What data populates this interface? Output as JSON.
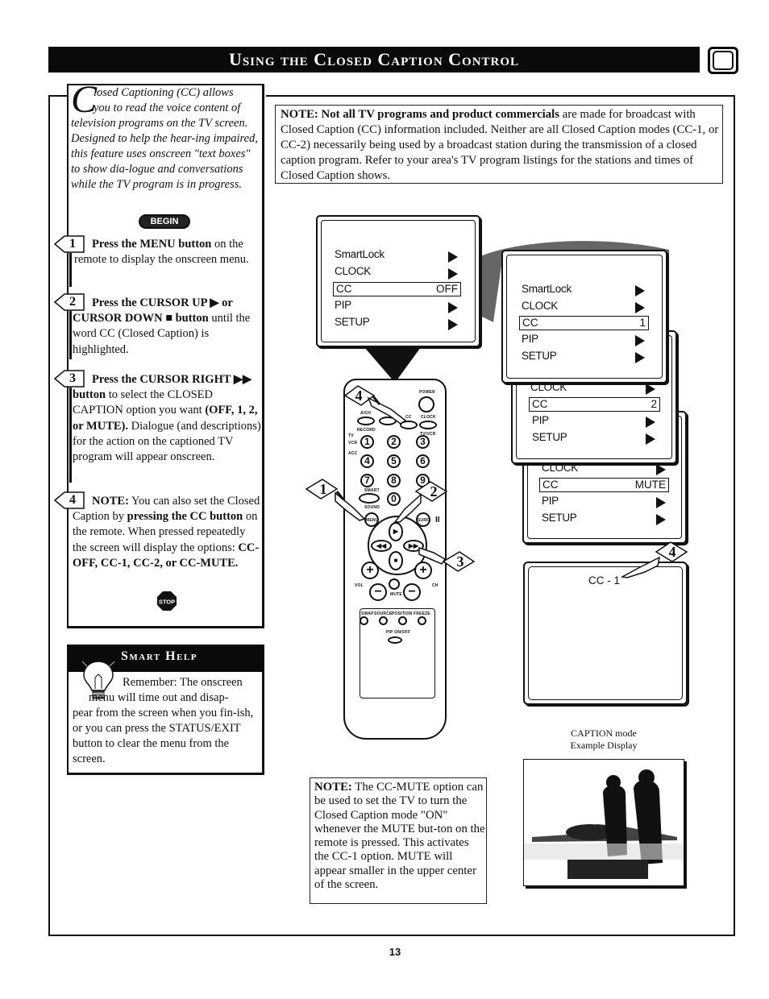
{
  "header": {
    "title": "Using the Closed Caption Control",
    "icon": "tv-screen-icon"
  },
  "intro": {
    "dropcap": "C",
    "line1": "losed Captioning (CC) allows",
    "line2": "you to read the voice content of",
    "rest": "television programs on the TV screen. Designed to help the hear-ing impaired, this feature uses onscreen \"text boxes\" to show dia-logue and conversations while the TV program is in progress."
  },
  "begin_badge": "BEGIN",
  "steps": [
    {
      "number": "1",
      "bold": "Press the MENU button",
      "text": " on the remote to display the onscreen menu."
    },
    {
      "number": "2",
      "bold": "Press the CURSOR UP ▶ or CURSOR DOWN ■ button",
      "text": " until the word CC (Closed Caption) is highlighted."
    },
    {
      "number": "3",
      "bold": "Press the CURSOR RIGHT ▶▶ button",
      "text": " to select the CLOSED CAPTION option you want ",
      "bold2": "(OFF, 1, 2, or MUTE).",
      "text2": " Dialogue (and descriptions) for the action on the captioned TV program will appear onscreen."
    },
    {
      "number": "4",
      "bold": "NOTE:",
      "text": " You can also set the Closed Caption by ",
      "bold2": "pressing the CC button",
      "text2": " on the remote. When pressed repeatedly the screen will display the options: ",
      "bold3": "CC-OFF, CC-1, CC-2, or CC-MUTE."
    }
  ],
  "stop_sign": "STOP",
  "smart_help": {
    "title": "Smart Help",
    "line1": "Remember: The onscreen",
    "line2": "menu will time out and disap-",
    "rest": "pear from the screen when you fin-ish, or you can press the STATUS/EXIT button to clear the menu from the screen."
  },
  "note_top": {
    "bold": "NOTE: Not all TV programs and product commercials",
    "text": " are made for broadcast with Closed Caption (CC) information included. Neither are all Closed Caption modes (CC-1, or CC-2) necessarily being used by a broadcast station during the transmission of a closed caption program. Refer to your area's TV program listings for the stations and times of Closed Caption shows."
  },
  "menus": [
    {
      "items": [
        "SmartLock",
        "CLOCK",
        "CC",
        "PIP",
        "SETUP"
      ],
      "cc_value": "OFF"
    },
    {
      "items": [
        "SmartLock",
        "CLOCK",
        "CC",
        "PIP",
        "SETUP"
      ],
      "cc_value": "1"
    },
    {
      "items": [
        "CLOCK",
        "CC",
        "PIP",
        "SETUP"
      ],
      "cc_value": "2"
    },
    {
      "items": [
        "CLOCK",
        "CC",
        "PIP",
        "SETUP"
      ],
      "cc_value": "MUTE"
    }
  ],
  "remote": {
    "labels": {
      "power": "POWER",
      "ach": "A/CH",
      "record": "RECORD",
      "cc": "CC",
      "clock": "CLOCK",
      "tvvcr": "TV/VCR",
      "tv": "TV",
      "vcr": "VCR",
      "acc": "ACC",
      "smart": "SMART",
      "sound": "SOUND",
      "menu": "MENU",
      "surf": "SURF",
      "vol": "VOL",
      "ch": "CH",
      "mute": "MUTE",
      "swap": "SWAP",
      "source": "SOURCE",
      "position": "POSITION",
      "freeze": "FREEZE",
      "pip_onoff": "PIP ON/OFF"
    },
    "digits": [
      "1",
      "2",
      "3",
      "4",
      "5",
      "6",
      "7",
      "8",
      "9",
      "0"
    ],
    "callouts": [
      "1",
      "2",
      "3",
      "4"
    ]
  },
  "example_display": {
    "screen_text": "CC - 1",
    "callout": "4",
    "caption_line1": "CAPTION mode",
    "caption_line2": "Example Display"
  },
  "note_bottom": {
    "bold": "NOTE:",
    "text": " The CC-MUTE option can be used to set the TV to turn the Closed Caption mode \"ON\" whenever the MUTE but-ton on the remote is pressed. This activates the CC-1 option. MUTE will appear smaller in the upper center of the screen."
  },
  "page_number": "13"
}
